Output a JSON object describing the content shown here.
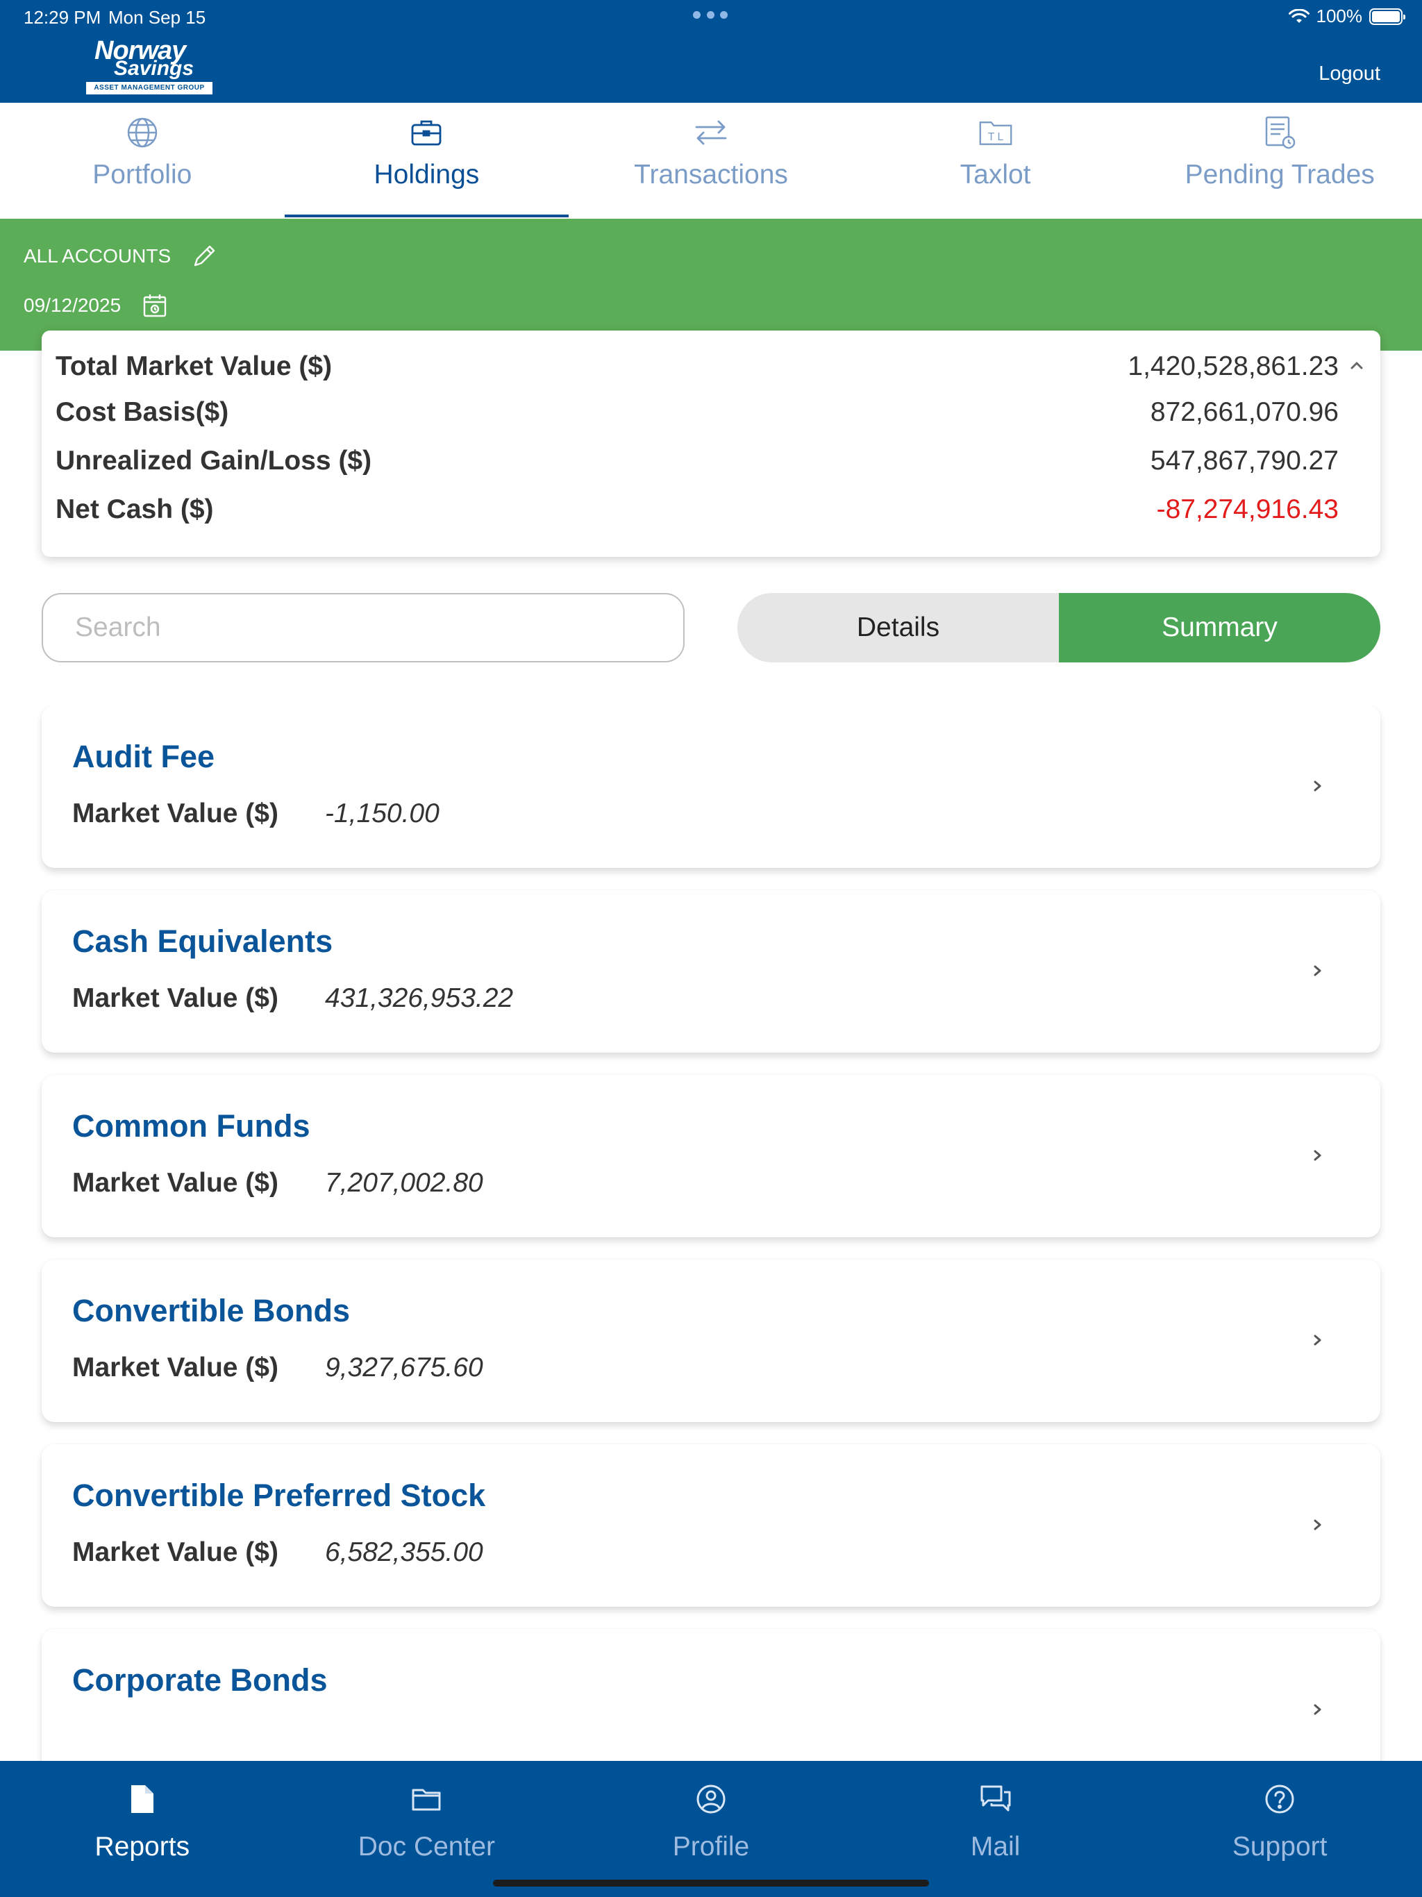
{
  "status": {
    "time": "12:29 PM",
    "date": "Mon Sep 15",
    "battery": "100%"
  },
  "brand": {
    "line1": "Norway",
    "line2": "Savings",
    "tagline": "ASSET MANAGEMENT GROUP"
  },
  "header": {
    "logout_label": "Logout"
  },
  "tabs": [
    {
      "label": "Portfolio",
      "icon": "globe-icon",
      "active": false
    },
    {
      "label": "Holdings",
      "icon": "briefcase-icon",
      "active": true
    },
    {
      "label": "Transactions",
      "icon": "transfer-arrows-icon",
      "active": false
    },
    {
      "label": "Taxlot",
      "icon": "taxlot-folder-icon",
      "active": false
    },
    {
      "label": "Pending Trades",
      "icon": "pending-doc-icon",
      "active": false
    }
  ],
  "filter": {
    "account": "ALL ACCOUNTS",
    "date": "09/12/2025"
  },
  "summary": {
    "total_market_value_label": "Total Market Value ($)",
    "total_market_value": "1,420,528,861.23",
    "cost_basis_label": "Cost Basis($)",
    "cost_basis": "872,661,070.96",
    "unrealized_label": "Unrealized Gain/Loss ($)",
    "unrealized": "547,867,790.27",
    "net_cash_label": "Net Cash ($)",
    "net_cash": "-87,274,916.43"
  },
  "search": {
    "placeholder": "Search",
    "value": ""
  },
  "view_toggle": {
    "details_label": "Details",
    "summary_label": "Summary",
    "selected": "Summary"
  },
  "holdings": [
    {
      "name": "Audit Fee",
      "mv_label": "Market Value ($)",
      "mv": "-1,150.00"
    },
    {
      "name": "Cash Equivalents",
      "mv_label": "Market Value ($)",
      "mv": "431,326,953.22"
    },
    {
      "name": "Common Funds",
      "mv_label": "Market Value ($)",
      "mv": "7,207,002.80"
    },
    {
      "name": "Convertible Bonds",
      "mv_label": "Market Value ($)",
      "mv": "9,327,675.60"
    },
    {
      "name": "Convertible Preferred Stock",
      "mv_label": "Market Value ($)",
      "mv": "6,582,355.00"
    },
    {
      "name": "Corporate Bonds"
    }
  ],
  "bottom_nav": [
    {
      "label": "Reports",
      "icon": "report-doc-icon",
      "active": true
    },
    {
      "label": "Doc Center",
      "icon": "folder-icon",
      "active": false
    },
    {
      "label": "Profile",
      "icon": "profile-icon",
      "active": false
    },
    {
      "label": "Mail",
      "icon": "chat-icon",
      "active": false
    },
    {
      "label": "Support",
      "icon": "help-circle-icon",
      "active": false
    }
  ],
  "colors": {
    "header_blue": "#005296",
    "band_green": "#5cad57",
    "toggle_green": "#4aa656",
    "link_blue": "#0a5599",
    "negative_red": "#e31b1b"
  }
}
